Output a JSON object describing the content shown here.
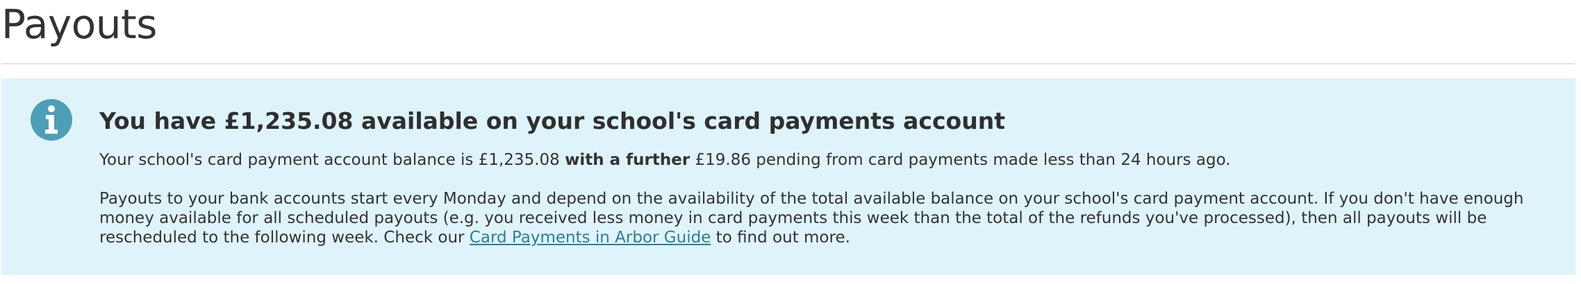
{
  "page": {
    "title": "Payouts"
  },
  "notice": {
    "icon": "info-icon",
    "heading": "You have £1,235.08 available on your school's card payments account",
    "balance_text_start": "Your school's card payment account balance is £1,235.08 ",
    "balance_text_bold": "with a further",
    "balance_text_end": " £19.86 pending from card payments made less than 24 hours ago.",
    "payout_text": "Payouts to your bank accounts start every Monday and depend on the availability of the total available balance on your school's card payment account. If you don't have enough money available for all scheduled payouts (e.g. you received less money in card payments this week than the total of the refunds you've processed), then all payouts will be rescheduled to the following week. Check our ",
    "guide_link_label": "Card Payments in Arbor Guide",
    "payout_text_end": " to find out more."
  },
  "colors": {
    "panel_background": "#dff4fa",
    "icon_color": "#4d9fb7",
    "link_color": "#2b7f95"
  }
}
